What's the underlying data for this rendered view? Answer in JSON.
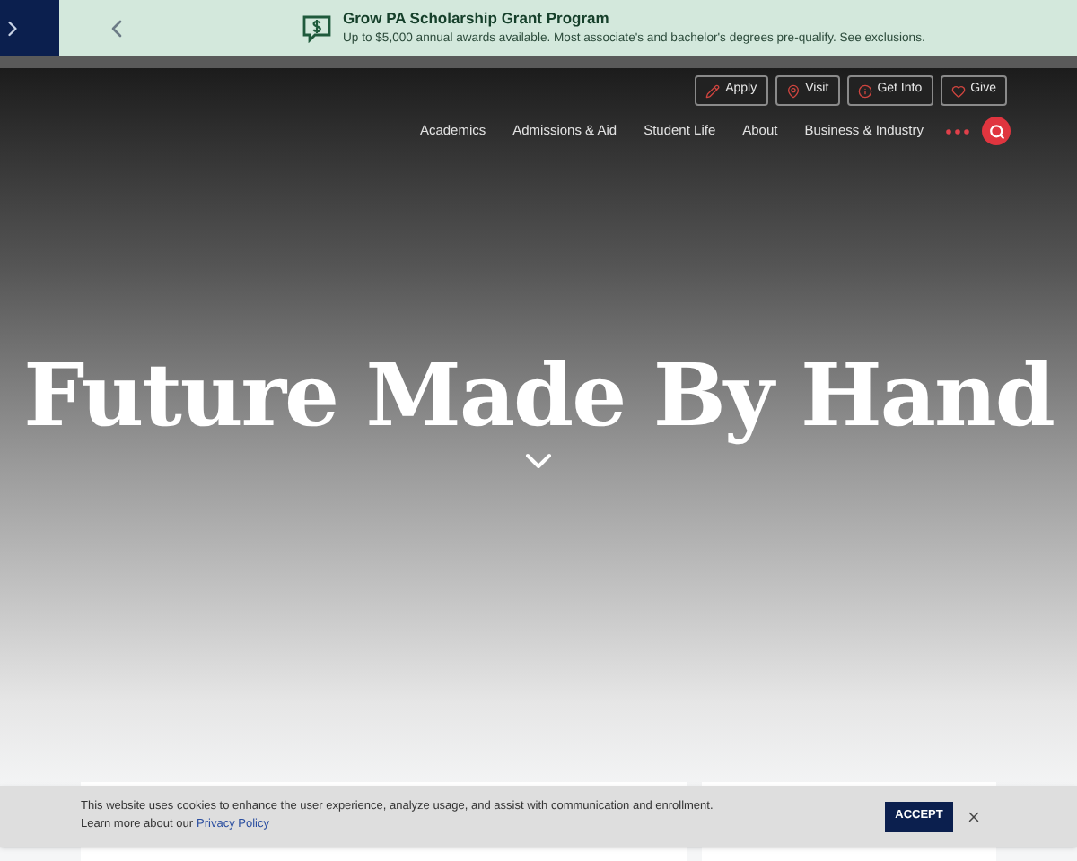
{
  "announcement": {
    "title": "Grow PA Scholarship Grant Program",
    "text": "Up to $5,000 annual awards available. Most associate's and bachelor's degrees pre-qualify. See exclusions."
  },
  "utility_links": [
    {
      "label": "Apply",
      "kind": "pencil"
    },
    {
      "label": "Visit",
      "kind": "pin"
    },
    {
      "label": "Get Info",
      "kind": "info"
    },
    {
      "label": "Give",
      "kind": "heart"
    }
  ],
  "nav": [
    "Academics",
    "Admissions & Aid",
    "Student Life",
    "About",
    "Business & Industry"
  ],
  "hero": {
    "title": "Future Made By Hand"
  },
  "cookie_banner": {
    "text": "This website uses cookies to enhance the user experience, analyze usage, and assist with communication and enrollment.",
    "link_prefix": "Learn more about our",
    "link": "Privacy Policy",
    "accept": "ACCEPT"
  }
}
